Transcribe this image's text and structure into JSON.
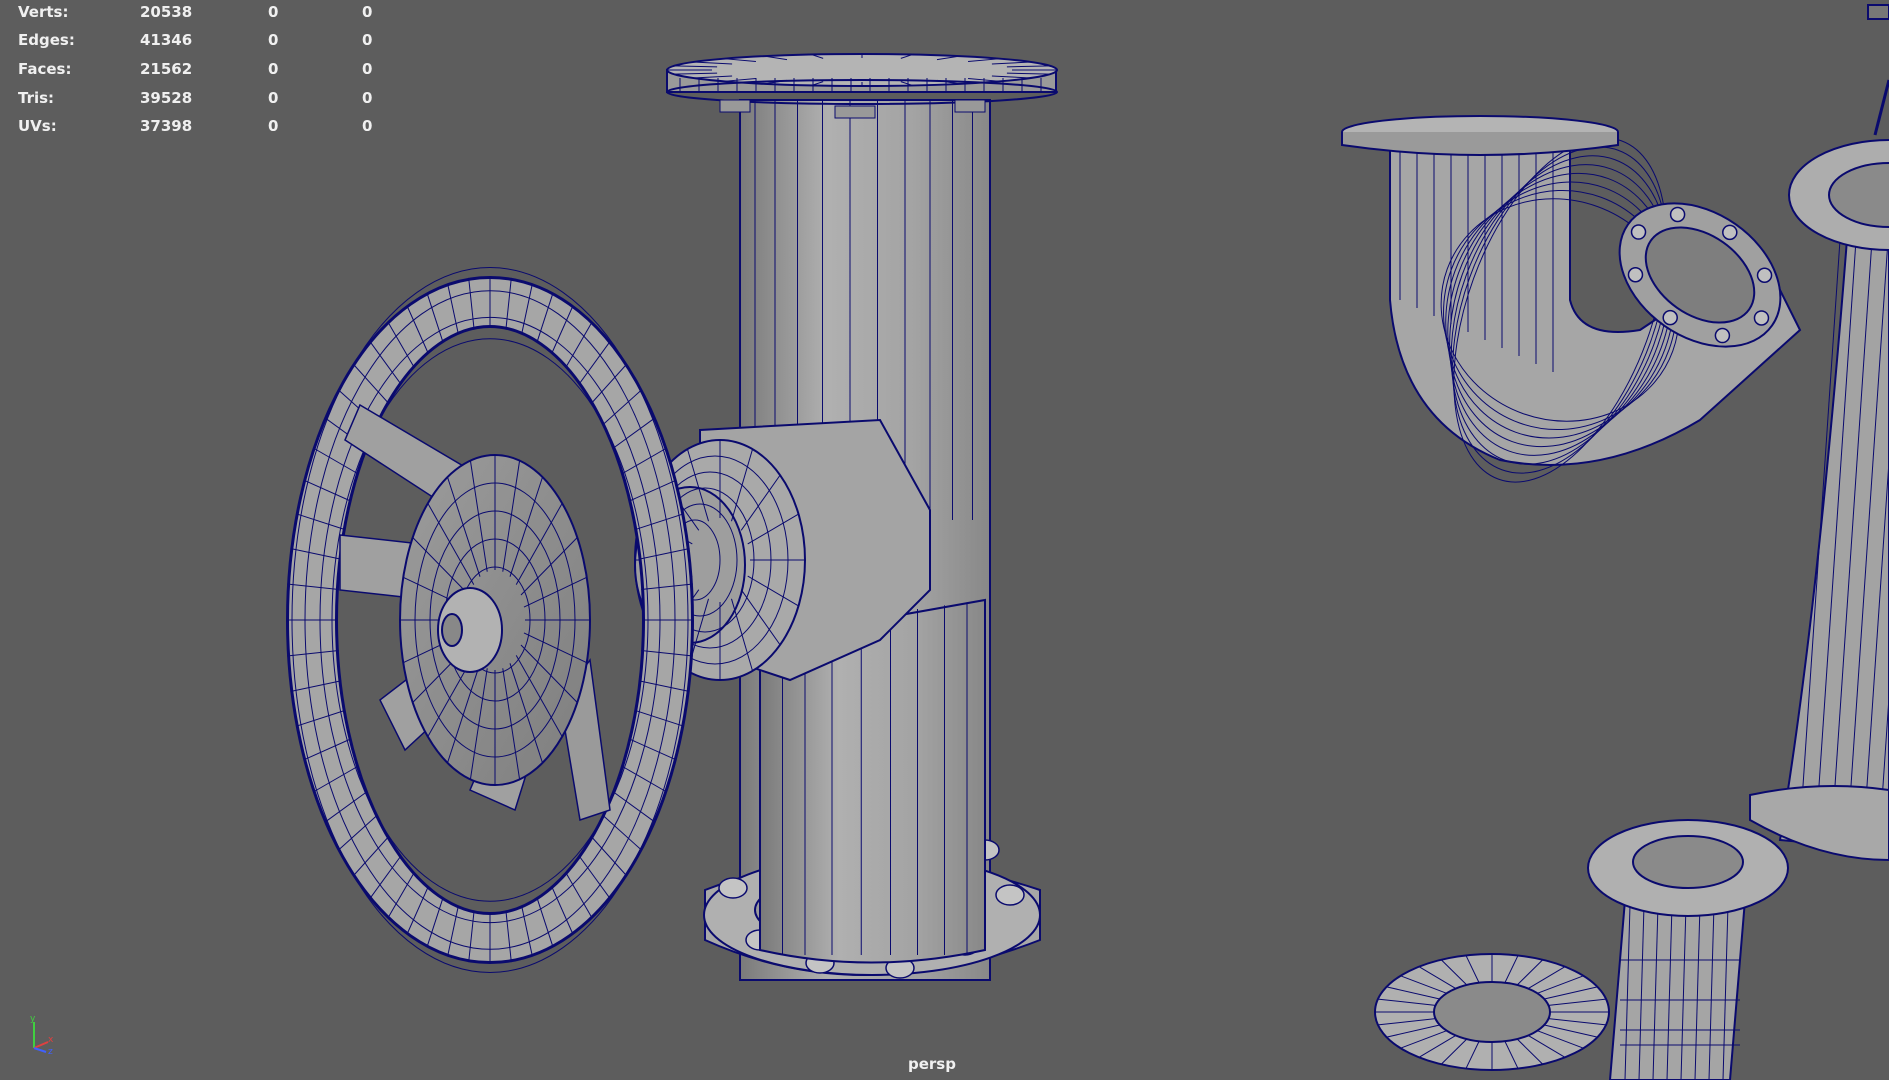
{
  "heads_up_display": {
    "rows": [
      {
        "label": "Verts:",
        "total": "20538",
        "selected": "0",
        "selected_uv": "0"
      },
      {
        "label": "Edges:",
        "total": "41346",
        "selected": "0",
        "selected_uv": "0"
      },
      {
        "label": "Faces:",
        "total": "21562",
        "selected": "0",
        "selected_uv": "0"
      },
      {
        "label": "Tris:",
        "total": "39528",
        "selected": "0",
        "selected_uv": "0"
      },
      {
        "label": "UVs:",
        "total": "37398",
        "selected": "0",
        "selected_uv": "0"
      }
    ]
  },
  "viewport": {
    "camera_name": "persp",
    "background_color": "#5d5d5d",
    "wireframe_color": "#0a0a6e",
    "mesh_color": "#a9a9a9"
  },
  "axis_gizmo": {
    "x_label": "x",
    "y_label": "y",
    "z_label": "z",
    "x_color": "#e04040",
    "y_color": "#40d040",
    "z_color": "#4060ff"
  }
}
